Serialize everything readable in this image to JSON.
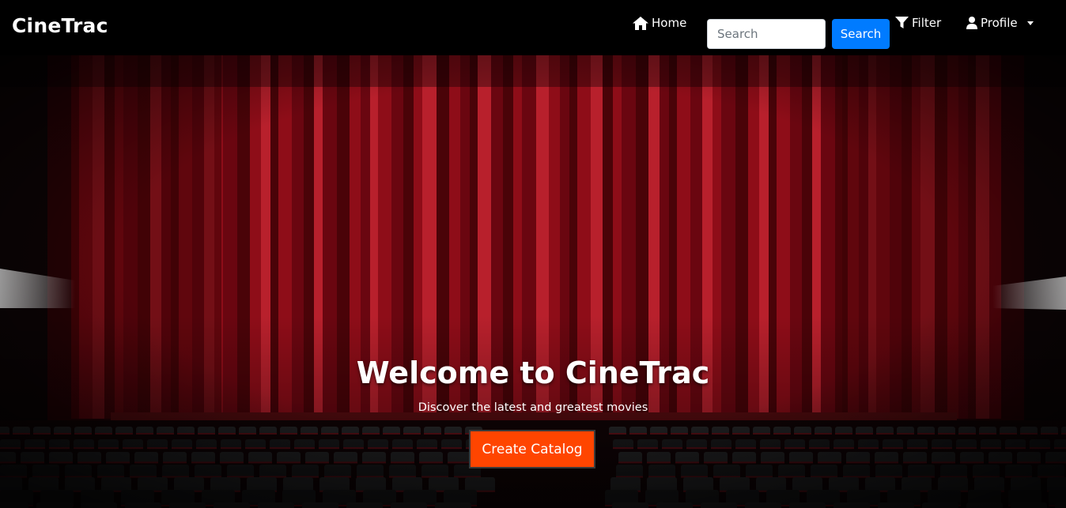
{
  "navbar": {
    "brand": "CineTrac",
    "home_label": "Home",
    "search_placeholder": "Search",
    "search_button": "Search",
    "filter_label": "Filter",
    "profile_label": "Profile",
    "icons": {
      "home": "home-icon",
      "filter": "filter-icon",
      "profile": "user-icon",
      "dropdown": "caret-down-icon"
    }
  },
  "hero": {
    "title": "Welcome to CineTrac",
    "subtitle": "Discover the latest and greatest movies",
    "cta_label": "Create Catalog",
    "background": "theater-curtain-stage-image"
  },
  "colors": {
    "navbar_bg": "#000000",
    "search_button": "#007bff",
    "cta": "#ff4500",
    "curtain": "#8b0a12"
  }
}
